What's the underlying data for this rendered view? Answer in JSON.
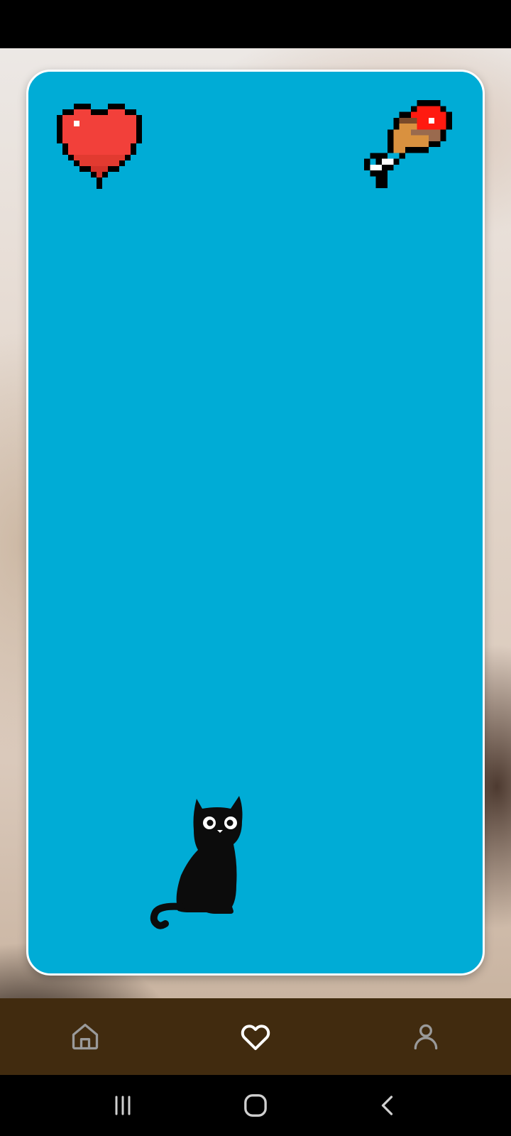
{
  "colors": {
    "game_background": "#00acd6",
    "nav_background": "#412b0f",
    "nav_icon_active": "#ffffff",
    "nav_icon_inactive": "#9a9a9a",
    "heart_red": "#f2403a",
    "meat_red": "#ff1a10",
    "meat_brown": "#9a6a4e",
    "meat_light": "#d9913f"
  },
  "hud": {
    "health_icon": "pixel-heart-icon",
    "food_icon": "pixel-drumstick-icon"
  },
  "pet": {
    "icon": "black-cat-sitting"
  },
  "bottom_nav": {
    "items": [
      {
        "icon": "home-icon",
        "active": false
      },
      {
        "icon": "heart-outline-icon",
        "active": true
      },
      {
        "icon": "user-icon",
        "active": false
      }
    ]
  },
  "system_nav": {
    "items": [
      "recents-icon",
      "home-circle-icon",
      "back-icon"
    ]
  }
}
